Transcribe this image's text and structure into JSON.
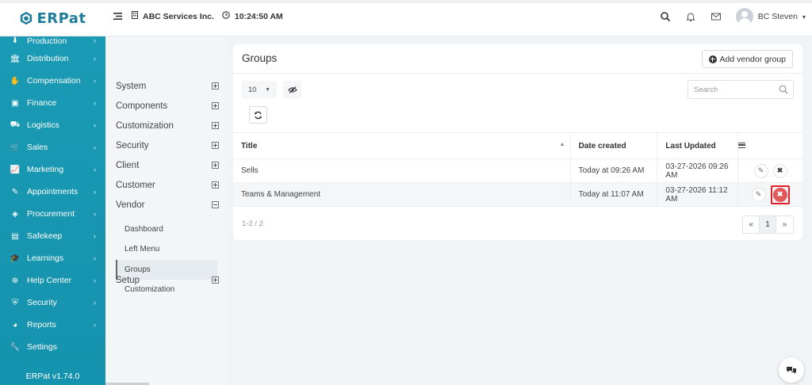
{
  "app": {
    "logo_text": "ERPat",
    "version": "ERPat v1.74.0"
  },
  "topbar": {
    "company": "ABC Services Inc.",
    "time": "10:24:50 AM",
    "user_name": "BC Steven"
  },
  "sidebar": {
    "items": [
      {
        "label": "Production",
        "icon": "production-icon",
        "glyph": "⬇"
      },
      {
        "label": "Distribution",
        "icon": "bank-icon",
        "glyph": "🏛"
      },
      {
        "label": "Compensation",
        "icon": "handshake-icon",
        "glyph": "✋"
      },
      {
        "label": "Finance",
        "icon": "money-icon",
        "glyph": "▣"
      },
      {
        "label": "Logistics",
        "icon": "truck-icon",
        "glyph": "⛟"
      },
      {
        "label": "Sales",
        "icon": "cart-icon",
        "glyph": "🛒"
      },
      {
        "label": "Marketing",
        "icon": "chart-line-icon",
        "glyph": "📈"
      },
      {
        "label": "Appointments",
        "icon": "calendar-edit-icon",
        "glyph": "✎"
      },
      {
        "label": "Procurement",
        "icon": "cubes-icon",
        "glyph": "◈"
      },
      {
        "label": "Safekeep",
        "icon": "archive-icon",
        "glyph": "▤"
      },
      {
        "label": "Learnings",
        "icon": "graduation-cap-icon",
        "glyph": "🎓"
      },
      {
        "label": "Help Center",
        "icon": "lifebuoy-icon",
        "glyph": "⊕"
      },
      {
        "label": "Security",
        "icon": "shield-icon",
        "glyph": "⛨"
      },
      {
        "label": "Reports",
        "icon": "pie-chart-icon",
        "glyph": "◕"
      },
      {
        "label": "Settings",
        "icon": "wrench-icon",
        "glyph": "🔧"
      }
    ]
  },
  "submenu": {
    "items": [
      "System",
      "Components",
      "Customization",
      "Security",
      "Client",
      "Customer",
      "Vendor"
    ],
    "vendor_children": [
      "Dashboard",
      "Left Menu",
      "Groups",
      "Customization"
    ],
    "setup": "Setup"
  },
  "main": {
    "title": "Groups",
    "add_button": "Add vendor group",
    "page_size": "10",
    "search_placeholder": "Search",
    "columns": {
      "title": "Title",
      "date_created": "Date created",
      "last_updated": "Last Updated"
    },
    "rows": [
      {
        "title": "Sells",
        "date_created": "Today at 09:26 AM",
        "last_updated": "03-27-2026 09:26 AM"
      },
      {
        "title": "Teams & Management",
        "date_created": "Today at 11:07 AM",
        "last_updated": "03-27-2026 11:12 AM"
      }
    ],
    "count": "1-2 / 2",
    "pager": {
      "prev": "«",
      "page": "1",
      "next": "»"
    }
  },
  "colors": {
    "sidebar": "#1a9ab4",
    "logo": "#1e7e9a",
    "delete_active": "#e05a5a",
    "highlight": "#e0202a"
  }
}
